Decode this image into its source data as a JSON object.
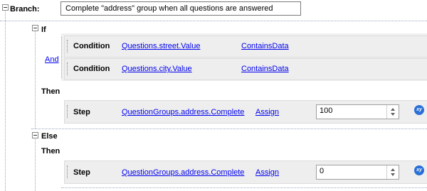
{
  "branch": {
    "label": "Branch:",
    "description": "Complete \"address\" group when all questions are answered"
  },
  "if_block": {
    "label": "If",
    "conjunction": "And",
    "conditions": [
      {
        "type_label": "Condition",
        "field": "Questions.street.Value",
        "operator": "ContainsData"
      },
      {
        "type_label": "Condition",
        "field": "Questions.city.Value",
        "operator": "ContainsData"
      }
    ],
    "then_label": "Then",
    "step": {
      "type_label": "Step",
      "target": "QuestionGroups.address.Complete",
      "action": "Assign",
      "value": "100",
      "xy_icon": "xy"
    }
  },
  "else_block": {
    "label": "Else",
    "then_label": "Then",
    "step": {
      "type_label": "Step",
      "target": "QuestionGroups.address.Complete",
      "action": "Assign",
      "value": "0",
      "xy_icon": "xy"
    }
  }
}
